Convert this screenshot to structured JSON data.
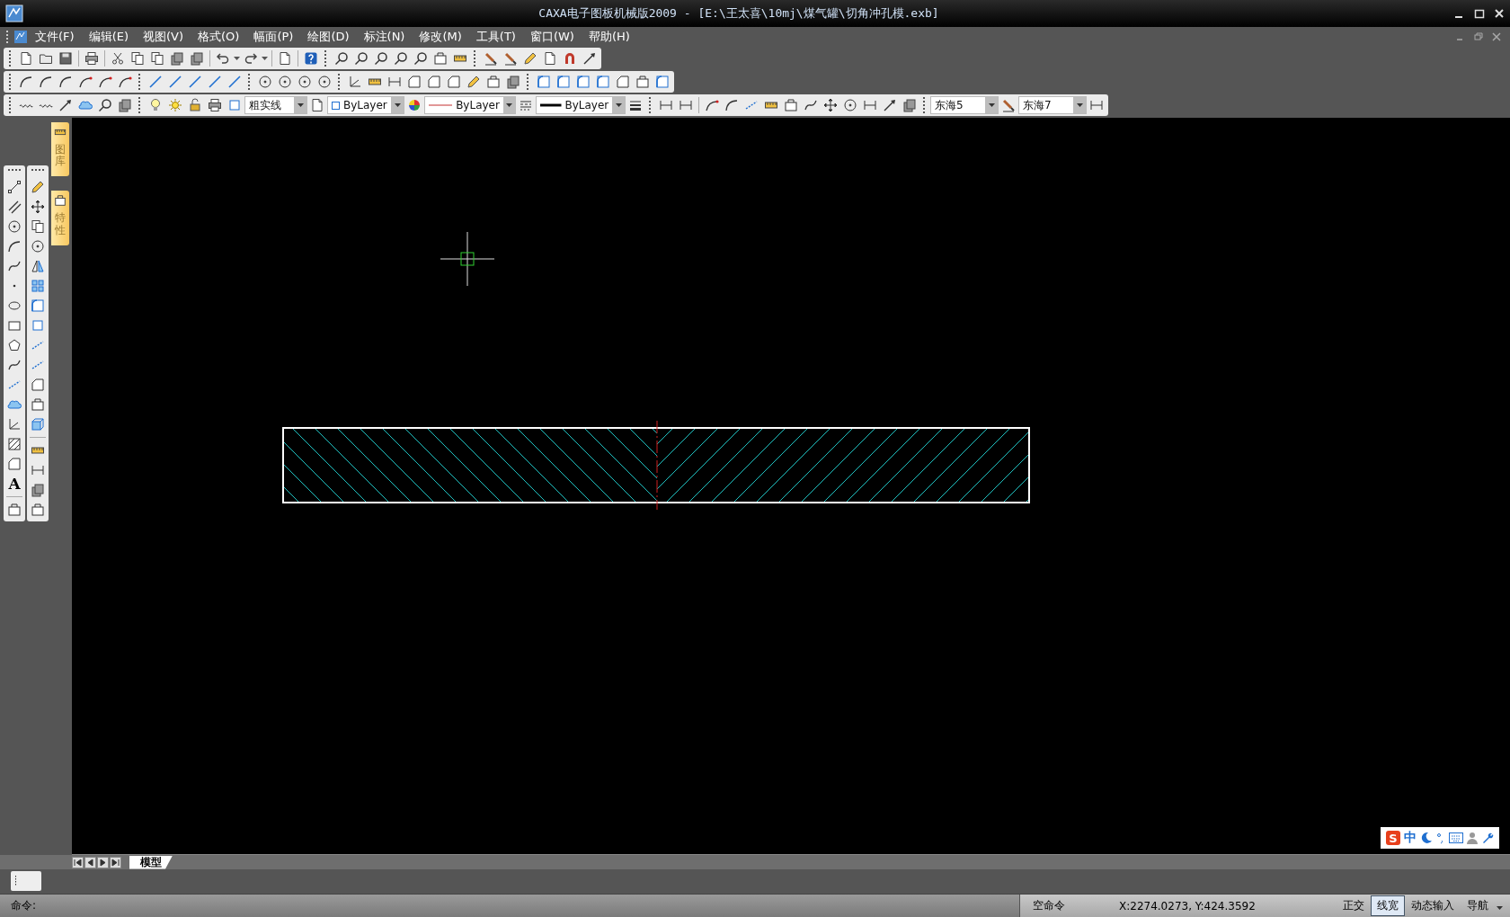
{
  "window": {
    "title": "CAXA电子图板机械版2009 - [E:\\王太喜\\10mj\\煤气罐\\切角冲孔模.exb]"
  },
  "menu": [
    "文件(F)",
    "编辑(E)",
    "视图(V)",
    "格式(O)",
    "幅面(P)",
    "绘图(D)",
    "标注(N)",
    "修改(M)",
    "工具(T)",
    "窗口(W)",
    "帮助(H)"
  ],
  "properties_toolbar": {
    "layer": "粗实线",
    "layer_color_setting": "ByLayer",
    "linetype": "ByLayer",
    "lineweight": "ByLayer"
  },
  "style_toolbar": {
    "text_style": "东海5",
    "dim_style": "东海7"
  },
  "draw_toolbar": {
    "text_tool": "A"
  },
  "side_tabs": [
    {
      "label": "图库"
    },
    {
      "label": "特性"
    }
  ],
  "layout_tabs": [
    {
      "label": "模型",
      "selected": true
    }
  ],
  "ime": {
    "logo": "S",
    "mode": "中"
  },
  "command_line": {
    "prompt": "命令:"
  },
  "status_bar": {
    "command": "空命令",
    "coordinates": "X:2274.0273, Y:424.3592",
    "toggles": [
      {
        "label": "正交",
        "on": false
      },
      {
        "label": "线宽",
        "on": true
      },
      {
        "label": "动态输入",
        "on": false
      },
      {
        "label": "导航",
        "on": false
      }
    ]
  }
}
